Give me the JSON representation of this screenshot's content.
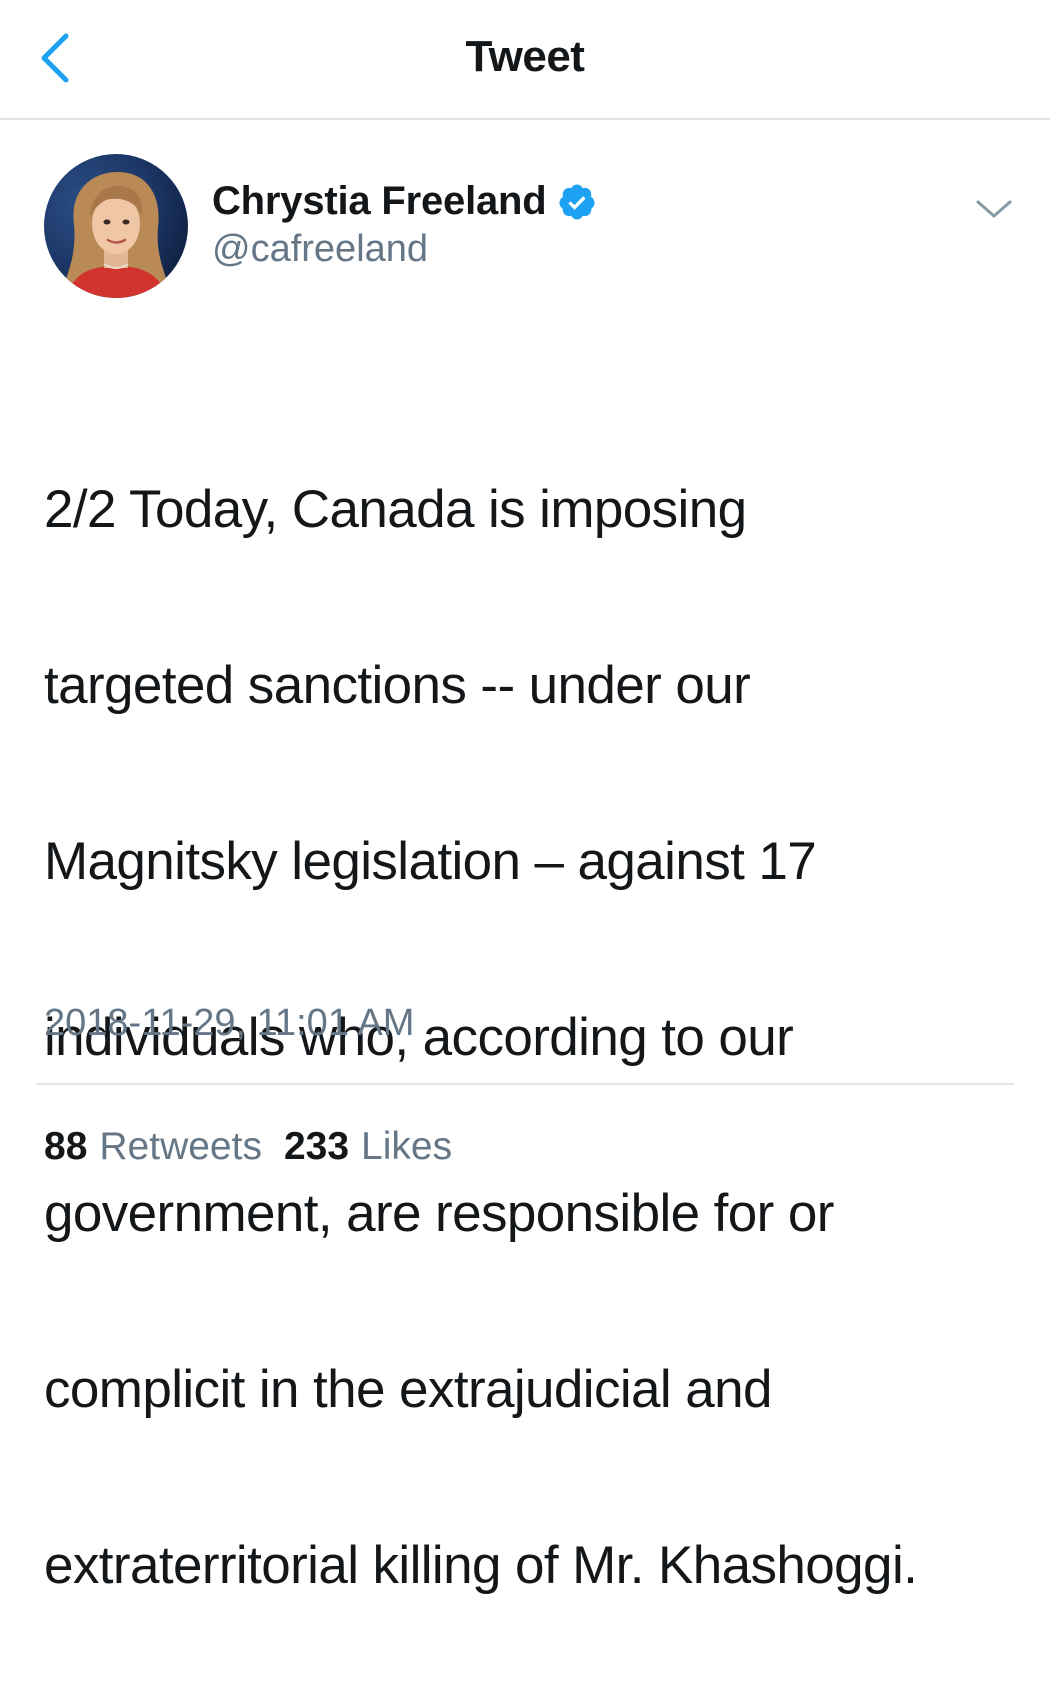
{
  "nav": {
    "title": "Tweet",
    "back_icon": "chevron-left-icon"
  },
  "author": {
    "display_name": "Chrystia Freeland",
    "handle": "@cafreeland",
    "verified": true,
    "verified_icon": "verified-badge-icon",
    "avatar_icon": "profile-photo"
  },
  "tweet": {
    "text_lines": [
      "2/2 Today, Canada is imposing",
      "targeted sanctions -- under our",
      "Magnitsky legislation – against 17",
      "individuals who, according to our",
      "government, are responsible for or",
      "complicit in the extrajudicial and",
      "extraterritorial killing of Mr. Khashoggi."
    ],
    "timestamp": "2018-11-29, 11:01 AM",
    "menu_icon": "chevron-down-icon"
  },
  "stats": {
    "retweets_count": "88",
    "retweets_label": "Retweets",
    "likes_count": "233",
    "likes_label": "Likes"
  },
  "colors": {
    "accent": "#1da1f2",
    "text_primary": "#14171a",
    "text_secondary": "#657786",
    "divider": "#e1e8ed"
  }
}
